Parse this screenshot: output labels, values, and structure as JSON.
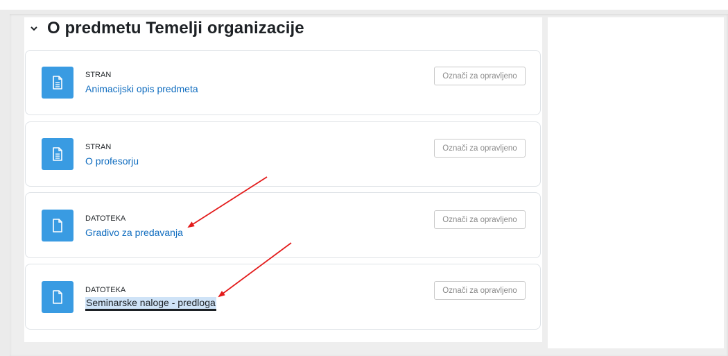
{
  "section": {
    "title": "O predmetu Temelji organizacije"
  },
  "activities": [
    {
      "type": "STRAN",
      "name": "Animacijski opis predmeta",
      "icon": "page-icon",
      "button": "Označi za opravljeno"
    },
    {
      "type": "STRAN",
      "name": "O profesorju",
      "icon": "page-icon",
      "button": "Označi za opravljeno"
    },
    {
      "type": "DATOTEKA",
      "name": "Gradivo za predavanja",
      "icon": "file-icon",
      "button": "Označi za opravljeno"
    },
    {
      "type": "DATOTEKA",
      "name": "Seminarske naloge - predloga",
      "icon": "file-icon",
      "button": "Označi za opravljeno"
    }
  ],
  "colors": {
    "icon_bg": "#399be2",
    "link": "#0f6cbf",
    "annotation_arrow": "#e31b1b",
    "selection": "#cfe3f7"
  }
}
